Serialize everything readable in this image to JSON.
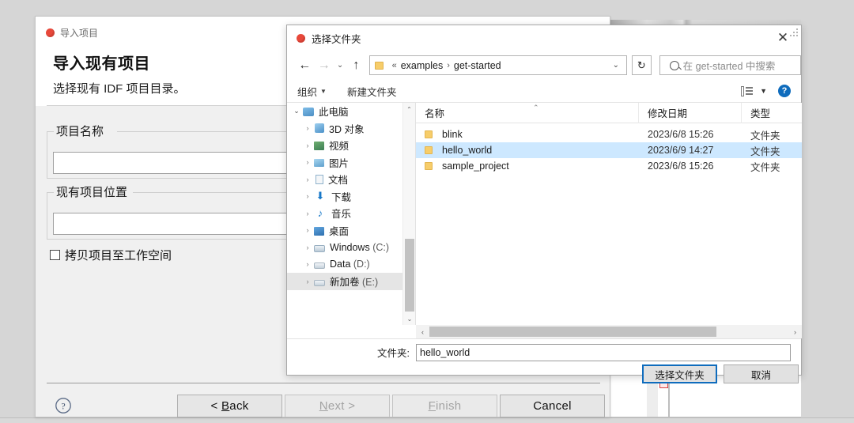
{
  "wizard": {
    "tab_label": "导入项目",
    "title": "导入现有项目",
    "subtitle": "选择现有 IDF 项目目录。",
    "group_project_name": "项目名称",
    "project_name_value": "",
    "group_project_location": "现有项目位置",
    "project_location_value": "",
    "checkbox_label": "拷贝项目至工作空间",
    "help_icon": "question-mark-icon",
    "buttons": {
      "back": "< Back",
      "back_plain": "Back",
      "next": "Next >",
      "finish": "Finish",
      "cancel": "Cancel"
    }
  },
  "file_dialog": {
    "title": "选择文件夹",
    "close_label": "✕",
    "nav": {
      "back_icon": "arrow-left-icon",
      "forward_icon": "arrow-right-icon",
      "recent_icon": "chevron-down-icon",
      "up_icon": "arrow-up-icon",
      "address_crumb_1": "examples",
      "address_crumb_2": "get-started",
      "address_prefix": "«",
      "address_sep": "›",
      "address_caret": "⌄",
      "refresh_icon": "↻",
      "search_placeholder": "在 get-started 中搜索"
    },
    "toolbar": {
      "organize": "组织",
      "new_folder": "新建文件夹",
      "view_icon": "view-list-icon",
      "view_caret": "▼",
      "help_icon": "help-circle-icon",
      "help_glyph": "?"
    },
    "tree": [
      {
        "label": "此电脑",
        "icon": "this-pc-icon",
        "chevron": "⌄",
        "expanded": true,
        "depth": 0,
        "selected": false
      },
      {
        "label": "3D 对象",
        "icon": "3d-objects-icon",
        "chevron": "›",
        "expanded": false,
        "depth": 1,
        "selected": false
      },
      {
        "label": "视频",
        "icon": "videos-icon",
        "chevron": "›",
        "expanded": false,
        "depth": 1,
        "selected": false
      },
      {
        "label": "图片",
        "icon": "pictures-icon",
        "chevron": "›",
        "expanded": false,
        "depth": 1,
        "selected": false
      },
      {
        "label": "文档",
        "icon": "documents-icon",
        "chevron": "›",
        "expanded": false,
        "depth": 1,
        "selected": false
      },
      {
        "label": "下载",
        "icon": "downloads-icon",
        "chevron": "›",
        "expanded": false,
        "depth": 1,
        "selected": false
      },
      {
        "label": "音乐",
        "icon": "music-icon",
        "chevron": "›",
        "expanded": false,
        "depth": 1,
        "selected": false
      },
      {
        "label": "桌面",
        "icon": "desktop-icon",
        "chevron": "›",
        "expanded": false,
        "depth": 1,
        "selected": false
      },
      {
        "label": "Windows (C:)",
        "icon": "system-drive-icon",
        "chevron": "›",
        "expanded": false,
        "depth": 1,
        "selected": false
      },
      {
        "label": "Data (D:)",
        "icon": "drive-icon",
        "chevron": "›",
        "expanded": false,
        "depth": 1,
        "selected": false
      },
      {
        "label": "新加卷 (E:)",
        "icon": "drive-icon",
        "chevron": "›",
        "expanded": false,
        "depth": 1,
        "selected": true
      }
    ],
    "columns": [
      "名称",
      "修改日期",
      "类型"
    ],
    "rows": [
      {
        "name": "blink",
        "date": "2023/6/8 15:26",
        "type": "文件夹",
        "selected": false
      },
      {
        "name": "hello_world",
        "date": "2023/6/9 14:27",
        "type": "文件夹",
        "selected": true
      },
      {
        "name": "sample_project",
        "date": "2023/6/8 15:26",
        "type": "文件夹",
        "selected": false
      }
    ],
    "folder_field_label": "文件夹:",
    "folder_field_value": "hello_world",
    "select_button": "选择文件夹",
    "cancel_button": "取消",
    "scroll": {
      "up_arrow": "⌃",
      "down_arrow": "⌄",
      "left_arrow": "‹",
      "right_arrow": "›"
    }
  },
  "colors": {
    "accent_blue": "#0f6cbd",
    "selection_blue": "#cde8ff",
    "tab_dot_red": "#e8483a",
    "folder_yellow": "#f7cd6a"
  }
}
